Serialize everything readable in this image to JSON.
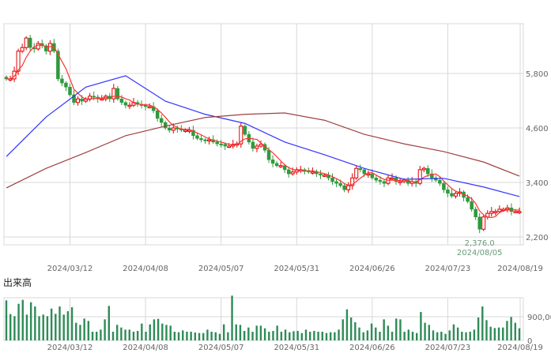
{
  "chart_data": [
    {
      "type": "candlestick",
      "ylim": [
        2000,
        6800
      ],
      "y_ticks": [
        "5,800",
        "4,600",
        "3,400",
        "2,200"
      ],
      "y_tick_values": [
        5800,
        4600,
        3400,
        2200
      ],
      "x_ticks": [
        "2024/03/12",
        "2024/04/08",
        "2024/05/07",
        "2024/05/31",
        "2024/06/26",
        "2024/07/23",
        "2024/08/19"
      ],
      "x_tick_bar_index": [
        16,
        35,
        54,
        73,
        92,
        111,
        130
      ],
      "grid": true,
      "colors": {
        "up": "#dd0000",
        "down": "#2e9a3c",
        "ma5": "#ff3333",
        "ma25": "#3333ff",
        "ma75": "#a04040",
        "grid": "#d8d8d8"
      },
      "close": [
        5680,
        5680,
        5850,
        6290,
        6370,
        6580,
        6370,
        6340,
        6460,
        6410,
        6290,
        6460,
        6290,
        5680,
        5590,
        5500,
        5330,
        5160,
        5240,
        5190,
        5240,
        5300,
        5280,
        5240,
        5240,
        5300,
        5240,
        5470,
        5240,
        5160,
        5100,
        5100,
        5160,
        5120,
        5100,
        5070,
        5070,
        4980,
        4810,
        4720,
        4600,
        4550,
        4600,
        4580,
        4550,
        4550,
        4550,
        4430,
        4370,
        4340,
        4320,
        4340,
        4290,
        4250,
        4240,
        4200,
        4200,
        4240,
        4250,
        4640,
        4460,
        4290,
        4150,
        4200,
        4240,
        4110,
        3900,
        3820,
        3770,
        3770,
        3680,
        3590,
        3630,
        3680,
        3680,
        3660,
        3630,
        3630,
        3590,
        3560,
        3560,
        3500,
        3420,
        3380,
        3330,
        3240,
        3330,
        3500,
        3710,
        3680,
        3590,
        3590,
        3500,
        3450,
        3420,
        3380,
        3500,
        3500,
        3420,
        3420,
        3450,
        3380,
        3420,
        3380,
        3680,
        3710,
        3590,
        3500,
        3450,
        3380,
        3240,
        3160,
        3100,
        3160,
        3190,
        3070,
        2980,
        2810,
        2640,
        2370,
        2640,
        2720,
        2760,
        2760,
        2810,
        2810,
        2840,
        2760,
        2760,
        2760
      ],
      "ma25_every_10_bars": [
        3970,
        4840,
        5500,
        5750,
        5190,
        4900,
        4700,
        4290,
        4010,
        3710,
        3470,
        3490,
        3300,
        3090
      ],
      "ma75_every_10_bars": [
        3280,
        3710,
        4060,
        4430,
        4640,
        4830,
        4900,
        4930,
        4770,
        4460,
        4250,
        4080,
        3850,
        3540
      ],
      "annotation": {
        "value": "2,376.0",
        "date": "2024/08/05"
      }
    },
    {
      "type": "bar",
      "title": "出来高",
      "ylim": [
        0,
        1800000
      ],
      "y_ticks": [
        "900,00",
        "0"
      ],
      "y_tick_values": [
        900000,
        0
      ],
      "x_ticks": [
        "2024/03/12",
        "2024/04/08",
        "2024/05/07",
        "2024/05/31",
        "2024/06/26",
        "2024/07/23",
        "2024/08/19"
      ],
      "color": "#2e8b57",
      "values": [
        1520000,
        1000000,
        920000,
        1390000,
        1540000,
        980000,
        1450000,
        1290000,
        920000,
        980000,
        920000,
        1210000,
        1010000,
        1290000,
        980000,
        1110000,
        1260000,
        670000,
        590000,
        830000,
        740000,
        330000,
        330000,
        410000,
        800000,
        1310000,
        330000,
        590000,
        490000,
        410000,
        410000,
        330000,
        360000,
        640000,
        330000,
        610000,
        800000,
        820000,
        640000,
        590000,
        560000,
        330000,
        310000,
        380000,
        330000,
        330000,
        300000,
        280000,
        280000,
        410000,
        330000,
        310000,
        250000,
        610000,
        310000,
        1700000,
        610000,
        590000,
        360000,
        490000,
        330000,
        560000,
        560000,
        460000,
        330000,
        360000,
        560000,
        330000,
        410000,
        310000,
        350000,
        360000,
        280000,
        410000,
        330000,
        360000,
        330000,
        330000,
        280000,
        310000,
        310000,
        410000,
        800000,
        1180000,
        870000,
        690000,
        490000,
        310000,
        380000,
        640000,
        490000,
        330000,
        800000,
        560000,
        330000,
        830000,
        800000,
        330000,
        410000,
        330000,
        280000,
        1080000,
        670000,
        590000,
        380000,
        310000,
        330000,
        250000,
        380000,
        610000,
        490000,
        330000,
        310000,
        330000,
        410000,
        870000,
        1290000,
        770000,
        520000,
        470000,
        490000,
        490000,
        740000,
        890000,
        670000,
        460000
      ]
    }
  ]
}
